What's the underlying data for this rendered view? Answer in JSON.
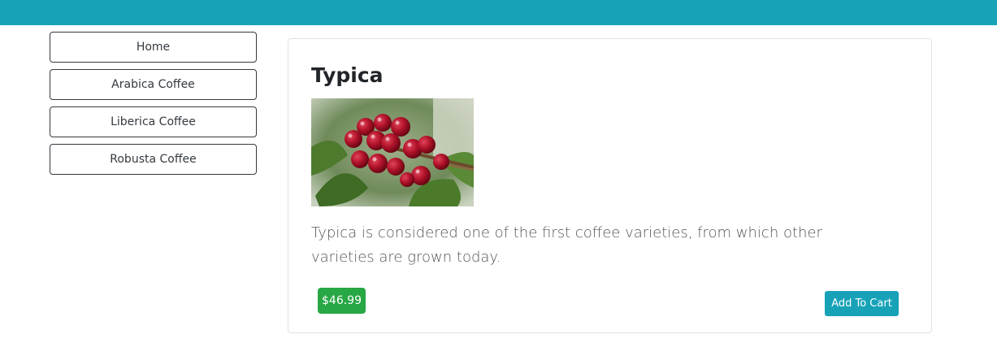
{
  "sidebar": {
    "items": [
      {
        "label": "Home"
      },
      {
        "label": "Arabica Coffee"
      },
      {
        "label": "Liberica Coffee"
      },
      {
        "label": "Robusta Coffee"
      }
    ]
  },
  "product": {
    "name": "Typica",
    "image_icon": "coffee-cherries-photo",
    "description": "Typica is considered one of the first coffee varieties, from which other varieties are grown today.",
    "price": "$46.99",
    "add_to_cart_label": "Add To Cart"
  },
  "colors": {
    "topbar": "#17a2b8",
    "price_badge": "#28a745",
    "cart_button": "#17a2b8"
  }
}
